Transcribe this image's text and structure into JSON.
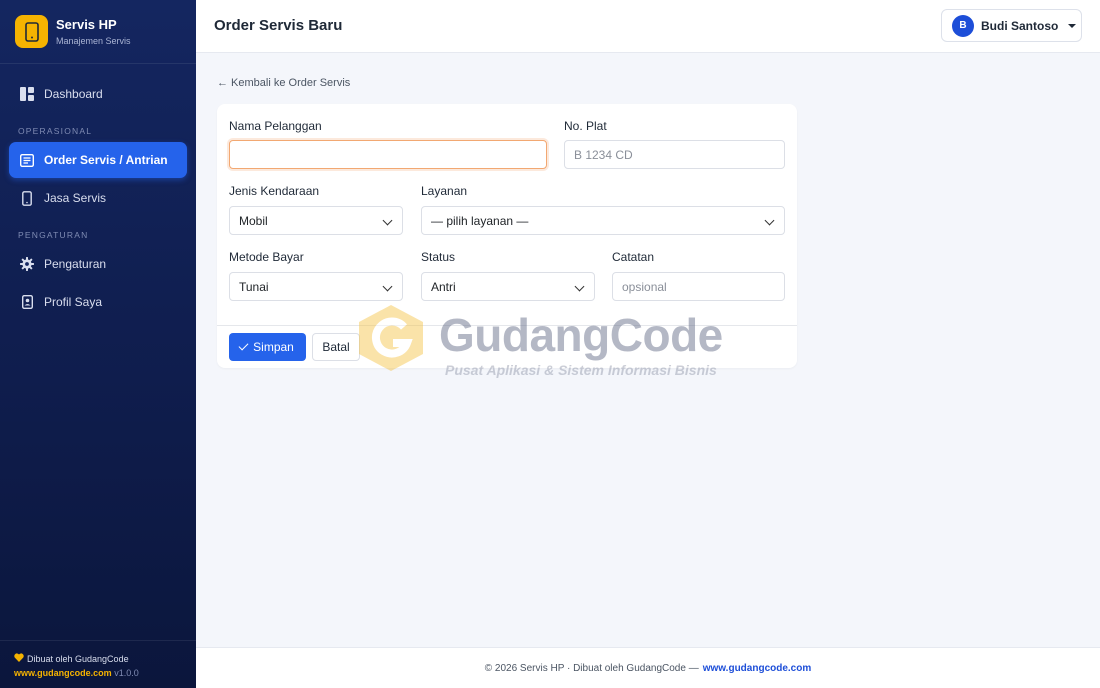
{
  "brand": {
    "title": "Servis HP",
    "subtitle": "Manajemen Servis"
  },
  "sidebar": {
    "dashboard": "Dashboard",
    "section_operasional": "OPERASIONAL",
    "order_servis": "Order Servis / Antrian",
    "jasa_servis": "Jasa Servis",
    "section_pengaturan": "PENGATURAN",
    "pengaturan": "Pengaturan",
    "profil": "Profil Saya",
    "footer_made_by": "Dibuat oleh GudangCode",
    "footer_link": "www.gudangcode.com",
    "footer_version": "v1.0.0"
  },
  "header": {
    "title": "Order Servis Baru",
    "user_initial": "B",
    "user_name": "Budi Santoso"
  },
  "back_link": "← Kembali ke Order Servis",
  "form": {
    "nama_label": "Nama Pelanggan",
    "nama_value": "",
    "plat_label": "No. Plat",
    "plat_placeholder": "B 1234 CD",
    "kendaraan_label": "Jenis Kendaraan",
    "kendaraan_value": "Mobil",
    "layanan_label": "Layanan",
    "layanan_value": "— pilih layanan —",
    "bayar_label": "Metode Bayar",
    "bayar_value": "Tunai",
    "status_label": "Status",
    "status_value": "Antri",
    "catatan_label": "Catatan",
    "catatan_placeholder": "opsional",
    "save_label": "Simpan",
    "cancel_label": "Batal"
  },
  "watermark": {
    "title": "GudangCode",
    "subtitle": "Pusat Aplikasi & Sistem Informasi Bisnis"
  },
  "footer": {
    "text": "© 2026 Servis HP · Dibuat oleh GudangCode —",
    "link": "www.gudangcode.com"
  },
  "colors": {
    "primary": "#2563eb",
    "brand_yellow": "#f5b301",
    "sidebar_bg": "#142660",
    "focus_border": "#f2a872"
  },
  "icons": {
    "brand": "phone-icon",
    "dashboard": "dashboard-icon",
    "order": "list-icon",
    "jasa": "phone-icon",
    "pengaturan": "gear-icon",
    "profil": "id-badge-icon",
    "save": "check-icon",
    "footer": "heart-icon"
  }
}
